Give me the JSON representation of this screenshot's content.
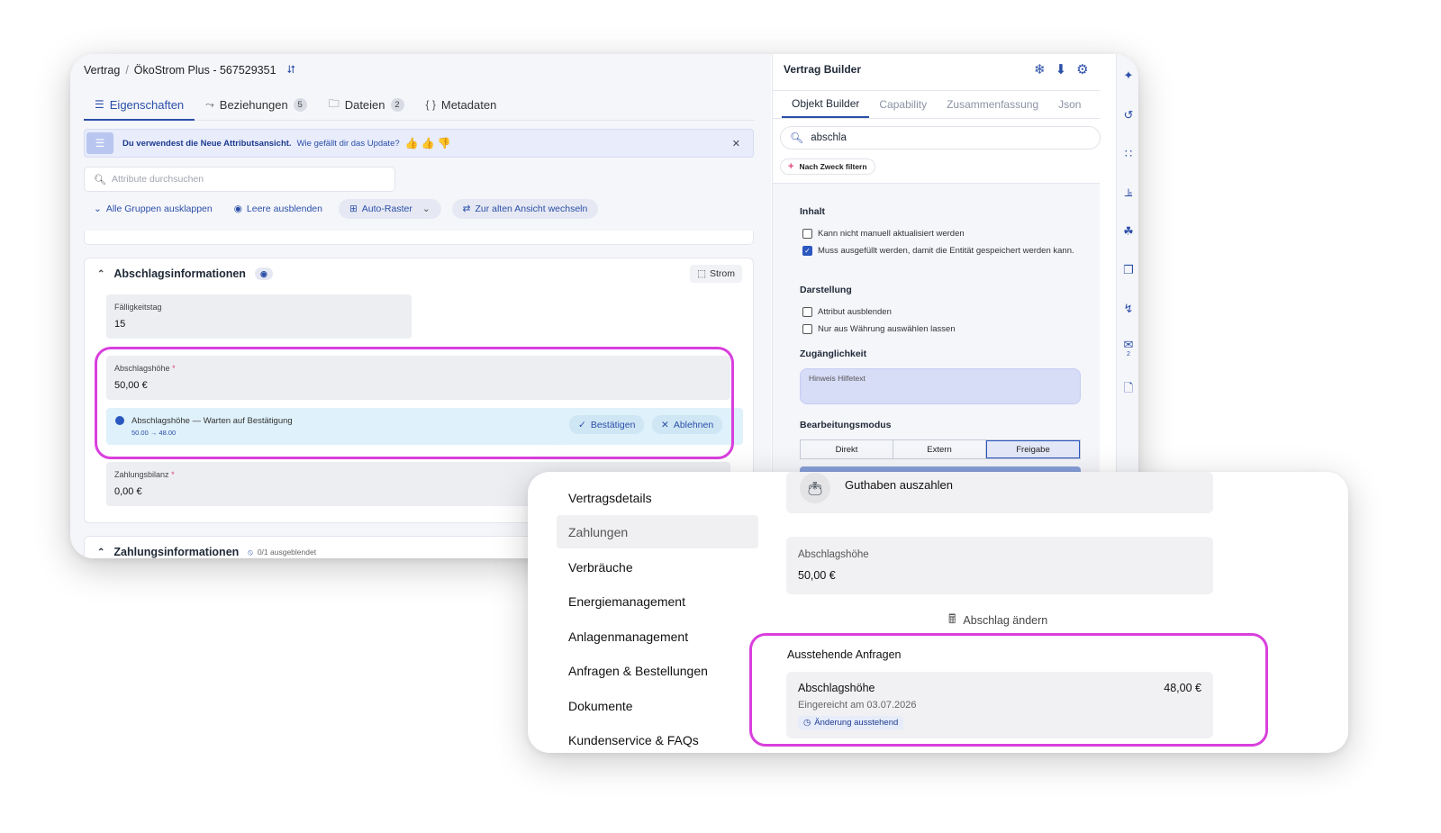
{
  "editor": {
    "breadcrumb": {
      "root": "Vertrag",
      "separator": "/",
      "current": "ÖkoStrom Plus - 567529351"
    },
    "tabs": [
      {
        "label": "Eigenschaften",
        "count": null,
        "icon": "list-icon"
      },
      {
        "label": "Beziehungen",
        "count": "5",
        "icon": "relations-icon"
      },
      {
        "label": "Dateien",
        "count": "2",
        "icon": "folder-icon"
      },
      {
        "label": "Metadaten",
        "count": null,
        "icon": "braces-icon"
      }
    ],
    "banner": {
      "title": "Du verwendest die Neue Attributsansicht.",
      "question": "Wie gefällt dir das Update?"
    },
    "search_placeholder": "Attribute durchsuchen",
    "actions": {
      "expand": "Alle Gruppen ausklappen",
      "hide_empty": "Leere ausblenden",
      "auto_grid": "Auto-Raster",
      "old_view": "Zur alten Ansicht wechseln"
    },
    "group": {
      "title": "Abschlagsinformationen",
      "tag": "Strom",
      "fields": [
        {
          "label": "Fälligkeitstag",
          "value": "15",
          "required": false
        },
        {
          "label": "Abschlagshöhe",
          "value": "50,00 €",
          "required": true
        },
        {
          "label": "Zahlungsbilanz",
          "value": "0,00 €",
          "required": true
        }
      ],
      "pending": {
        "text": "Abschlagshöhe — Warten auf Bestätigung",
        "change": "50.00 → 48.00",
        "confirm": "Bestätigen",
        "reject": "Ablehnen"
      }
    },
    "group2": {
      "title": "Zahlungsinformationen",
      "hidden_info": "0/1 ausgeblendet"
    }
  },
  "builder": {
    "title": "Vertrag Builder",
    "tabs": [
      "Objekt Builder",
      "Capability",
      "Zusammenfassung",
      "Json"
    ],
    "search_value": "abschla",
    "filter_label": "Nach Zweck filtern",
    "sections": {
      "inhalt": "Inhalt",
      "darstellung": "Darstellung",
      "zugang": "Zugänglichkeit",
      "modus": "Bearbeitungsmodus"
    },
    "checks": {
      "c1": "Kann nicht manuell aktualisiert werden",
      "c2": "Muss ausgefüllt werden, damit die Entität gespeichert werden kann.",
      "c3": "Attribut ausblenden",
      "c4": "Nur aus Währung auswählen lassen"
    },
    "hint_placeholder": "Hinweis Hilfetext",
    "modes": [
      "Direkt",
      "Extern",
      "Freigabe"
    ],
    "rail_badge": "2"
  },
  "portal": {
    "nav": [
      "Vertragsdetails",
      "Zahlungen",
      "Verbräuche",
      "Energiemanagement",
      "Anlagenmanagement",
      "Anfragen & Bestellungen",
      "Dokumente",
      "Kundenservice & FAQs"
    ],
    "payout": "Guthaben auszahlen",
    "amount_label": "Abschlagshöhe",
    "amount_value": "50,00 €",
    "change_link": "Abschlag ändern",
    "pending_title": "Ausstehende Anfragen",
    "request": {
      "title": "Abschlagshöhe",
      "amount": "48,00 €",
      "date": "Eingereicht am 03.07.2026",
      "status": "Änderung ausstehend"
    }
  },
  "colors": {
    "accent": "#2b4fa8",
    "highlight": "#d93fdd",
    "required": "#e0457b"
  }
}
